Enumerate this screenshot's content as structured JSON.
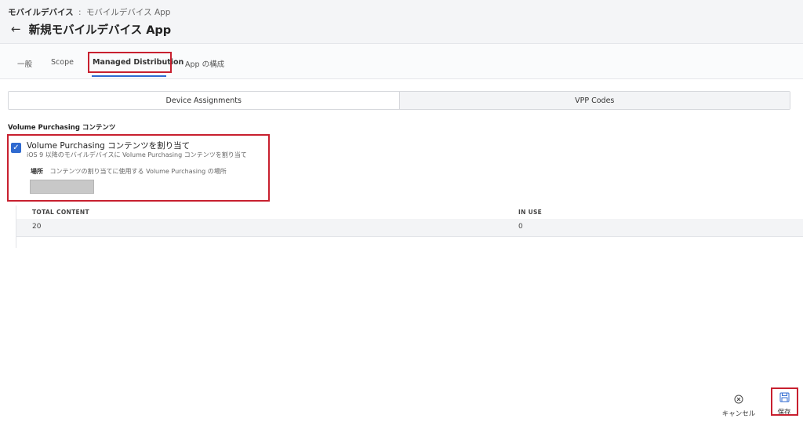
{
  "header": {
    "breadcrumb": {
      "root": "モバイルデバイス",
      "separator": ":",
      "current": "モバイルデバイス App"
    },
    "back_icon": "arrow-left-icon",
    "title": "新規モバイルデバイス App"
  },
  "tabs": [
    {
      "label": "一般",
      "active": false
    },
    {
      "label": "Scope",
      "active": false
    },
    {
      "label": "Managed Distribution",
      "active": true
    },
    {
      "label": "App の構成",
      "active": false
    }
  ],
  "segments": [
    {
      "label": "Device Assignments",
      "active": true
    },
    {
      "label": "VPP Codes",
      "active": false
    }
  ],
  "section": {
    "label": "Volume Purchasing コンテンツ",
    "checkbox": {
      "checked": true,
      "title": "Volume Purchasing コンテンツを割り当て",
      "description": "iOS 9 以降のモバイルデバイスに Volume Purchasing コンテンツを割り当て"
    },
    "location": {
      "label": "場所",
      "description": "コンテンツの割り当てに使用する Volume Purchasing の場所",
      "value": ""
    }
  },
  "table": {
    "columns": [
      "TOTAL CONTENT",
      "IN USE"
    ],
    "rows": [
      [
        "20",
        "0"
      ]
    ]
  },
  "actions": {
    "cancel": {
      "label": "キャンセル",
      "icon": "close-circle-icon"
    },
    "save": {
      "label": "保存",
      "icon": "save-icon"
    }
  },
  "colors": {
    "accent": "#2f6ad0",
    "highlight": "#c8202f",
    "header_bg": "#f4f5f7"
  }
}
